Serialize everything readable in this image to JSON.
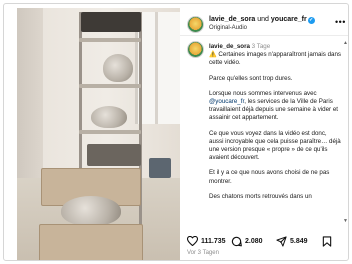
{
  "header": {
    "author": "lavie_de_sora",
    "joiner": "und",
    "coauthor": "youcare_fr",
    "verified_mark": "✓",
    "subtitle": "Original-Audio",
    "more_icon": "more-horizontal-icon",
    "more_glyph": "•••"
  },
  "caption": {
    "username": "lavie_de_sora",
    "time": "3 Tage",
    "paragraphs": [
      "⚠️ Certaines images n'apparaîtront jamais dans cette vidéo.",
      "Parce qu'elles sont trop dures.",
      "Lorsque nous sommes intervenus avec",
      "Ce que vous voyez dans la vidéo est donc, aussi incroyable que cela puisse paraître… déjà une version presque « propre » de ce qu'ils avaient découvert.",
      "Et il y a ce que nous avons choisi de ne pas montrer.",
      "Des chatons morts retrouvés dans un"
    ],
    "mention": "@youcare_fr",
    "p3_rest": ", les services de la Ville de Paris travaillaient déjà depuis une semaine à vider et assainir cet appartement."
  },
  "actions": {
    "likes": "111.735",
    "comments": "2.080",
    "shares": "5.849",
    "like_icon": "heart-icon",
    "comment_icon": "comment-icon",
    "share_icon": "share-icon",
    "save_icon": "bookmark-icon"
  },
  "timestamp": "Vor 3 Tagen",
  "colors": {
    "verified": "#1d9bf0",
    "mention": "#00376b",
    "muted": "#8e8e8e"
  }
}
